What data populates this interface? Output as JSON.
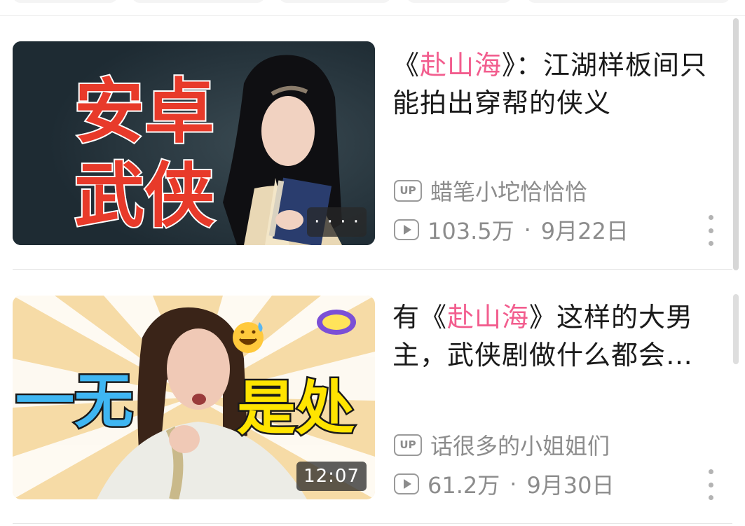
{
  "videos": [
    {
      "title_prefix": "《",
      "title_highlight": "赴山海",
      "title_suffix": "》：江湖样板间只能拍出穿帮的侠义",
      "thumb_text_top": "安卓",
      "thumb_text_bottom": "武侠",
      "duration": "· · · ·",
      "uploader": "蜡笔小坨恰恰恰",
      "views": "103.5万",
      "date": "9月22日"
    },
    {
      "title_prefix": "有《",
      "title_highlight": "赴山海",
      "title_suffix": "》这样的大男主，武侠剧做什么都会…",
      "thumb_text_left": "一无",
      "thumb_text_right": "是处",
      "duration": "12:07",
      "uploader": "话很多的小姐姐们",
      "views": "61.2万",
      "date": "9月30日"
    }
  ],
  "labels": {
    "up_badge": "UP",
    "separator": "·"
  },
  "colors": {
    "highlight": "#f25d8e",
    "meta": "#8c8c8c"
  }
}
